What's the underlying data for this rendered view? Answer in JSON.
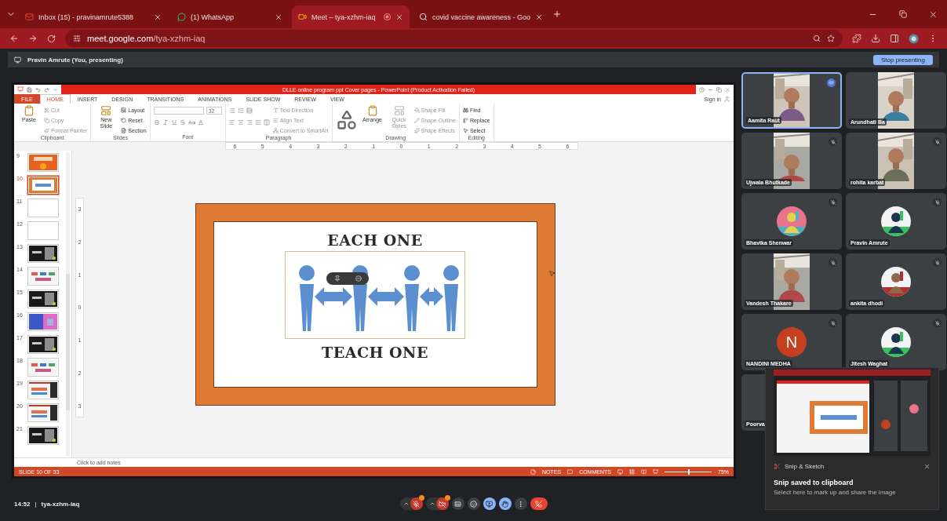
{
  "browser": {
    "tabs": [
      {
        "title": "Inbox (15) - pravinamrute5388",
        "selected": false,
        "recording": false
      },
      {
        "title": "(1) WhatsApp",
        "selected": false,
        "recording": false
      },
      {
        "title": "Meet – tya-xzhm-iaq",
        "selected": true,
        "recording": true
      },
      {
        "title": "covid vaccine awareness - Goo",
        "selected": false,
        "recording": false
      }
    ],
    "url_host": "meet.google.com",
    "url_path": "/tya-xzhm-iaq"
  },
  "presenting_bar": {
    "label": "Pravin Amrute (You, presenting)",
    "button": "Stop presenting"
  },
  "powerpoint": {
    "title": "DLLE online program ppt Cover pages - PowerPoint (Product Activation Failed)",
    "sign_in": "Sign in",
    "tabs": [
      {
        "label": "FILE",
        "kind": "file",
        "selected": false
      },
      {
        "label": "HOME",
        "kind": "tab",
        "selected": true
      },
      {
        "label": "INSERT",
        "kind": "tab",
        "selected": false
      },
      {
        "label": "DESIGN",
        "kind": "tab",
        "selected": false
      },
      {
        "label": "TRANSITIONS",
        "kind": "tab",
        "selected": false
      },
      {
        "label": "ANIMATIONS",
        "kind": "tab",
        "selected": false
      },
      {
        "label": "SLIDE SHOW",
        "kind": "tab",
        "selected": false
      },
      {
        "label": "REVIEW",
        "kind": "tab",
        "selected": false
      },
      {
        "label": "VIEW",
        "kind": "tab",
        "selected": false
      }
    ],
    "groups": [
      {
        "label": "Clipboard",
        "kind": "buttons",
        "large": [
          {
            "label": "Paste",
            "disabled": false
          }
        ],
        "small": [
          {
            "label": "Cut",
            "disabled": true
          },
          {
            "label": "Copy",
            "disabled": true
          },
          {
            "label": "Format Painter",
            "disabled": true
          }
        ]
      },
      {
        "label": "Slides",
        "kind": "buttons",
        "large": [
          {
            "label": "New Slide",
            "disabled": false
          }
        ],
        "small": [
          {
            "label": "Layout",
            "disabled": false
          },
          {
            "label": "Reset",
            "disabled": false
          },
          {
            "label": "Section",
            "disabled": false
          }
        ]
      },
      {
        "label": "Font",
        "kind": "font",
        "font_size": "32"
      },
      {
        "label": "Paragraph",
        "kind": "paragraph",
        "small": [
          {
            "label": "Text Direction",
            "disabled": true
          },
          {
            "label": "Align Text",
            "disabled": true
          },
          {
            "label": "Convert to SmartArt",
            "disabled": true
          }
        ]
      },
      {
        "label": "Drawing",
        "kind": "drawing",
        "large": [
          {
            "label": "Arrange",
            "disabled": false
          },
          {
            "label": "Quick Styles",
            "disabled": true
          }
        ],
        "small": [
          {
            "label": "Shape Fill",
            "disabled": true
          },
          {
            "label": "Shape Outline",
            "disabled": true
          },
          {
            "label": "Shape Effects",
            "disabled": true
          }
        ]
      },
      {
        "label": "Editing",
        "kind": "buttons",
        "small": [
          {
            "label": "Find",
            "disabled": false
          },
          {
            "label": "Replace",
            "disabled": false
          },
          {
            "label": "Select",
            "disabled": false
          }
        ]
      }
    ],
    "ruler": [
      "6",
      "5",
      "4",
      "3",
      "2",
      "1",
      "0",
      "1",
      "2",
      "3",
      "4",
      "5",
      "6"
    ],
    "vertical_ruler": [
      "3",
      "2",
      "1",
      "0",
      "1",
      "2",
      "3"
    ],
    "thumbnails": [
      {
        "number": "9",
        "kind": "orange",
        "selected": false
      },
      {
        "number": "10",
        "kind": "frame",
        "selected": true
      },
      {
        "number": "11",
        "kind": "blank",
        "selected": false
      },
      {
        "number": "12",
        "kind": "blank",
        "selected": false
      },
      {
        "number": "13",
        "kind": "dark",
        "selected": false
      },
      {
        "number": "14",
        "kind": "light",
        "selected": false
      },
      {
        "number": "15",
        "kind": "dark",
        "selected": false
      },
      {
        "number": "16",
        "kind": "pink",
        "selected": false
      },
      {
        "number": "17",
        "kind": "dark",
        "selected": false
      },
      {
        "number": "18",
        "kind": "light",
        "selected": false
      },
      {
        "number": "19",
        "kind": "split",
        "selected": false
      },
      {
        "number": "20",
        "kind": "split",
        "selected": false
      },
      {
        "number": "21",
        "kind": "dark",
        "selected": false
      }
    ],
    "slide": {
      "title": "EACH ONE",
      "subtitle": "TEACH ONE",
      "shape_selected": true
    },
    "notes_placeholder": "Click to add notes",
    "status": {
      "slide": "SLIDE 10 OF 33",
      "notes": "NOTES",
      "comments": "COMMENTS",
      "zoom": "75%",
      "level": 0.5
    }
  },
  "participants": [
    {
      "name": "Aamita Raut",
      "kind": "video",
      "speaking": true,
      "muted": false
    },
    {
      "name": "Arundhati Ba",
      "kind": "video",
      "speaking": false,
      "muted": false
    },
    {
      "name": "Ujwala Bhutkade",
      "kind": "video",
      "speaking": false,
      "muted": true
    },
    {
      "name": "rohita karbat",
      "kind": "video",
      "speaking": false,
      "muted": true
    },
    {
      "name": "Bhavika Shenwar",
      "kind": "avatar",
      "speaking": false,
      "muted": true
    },
    {
      "name": "Pravin Amrute",
      "kind": "avatar",
      "speaking": false,
      "muted": true
    },
    {
      "name": "Vandesh Thakare",
      "kind": "video",
      "speaking": false,
      "muted": true
    },
    {
      "name": "ankita dhodi",
      "kind": "avatar",
      "speaking": false,
      "muted": true
    },
    {
      "name": "NANDINI MEDHA",
      "kind": "initial",
      "initial": "N",
      "color": "#c5401f",
      "speaking": false,
      "muted": true
    },
    {
      "name": "Jitesh Waghat",
      "kind": "avatar",
      "speaking": false,
      "muted": true
    },
    {
      "name": "Poorva",
      "kind": "none",
      "speaking": false
    }
  ],
  "meeting": {
    "time": "14:52",
    "separator": "|",
    "code": "tya-xzhm-iaq",
    "controls": [
      {
        "kind": "mic",
        "on": false,
        "alert": true
      },
      {
        "kind": "camera",
        "on": false,
        "alert": true
      },
      {
        "kind": "captions",
        "on": false,
        "alert": false
      },
      {
        "kind": "emoji",
        "on": false,
        "alert": false
      },
      {
        "kind": "present",
        "on": true,
        "alert": false
      },
      {
        "kind": "hand",
        "on": true,
        "alert": false
      },
      {
        "kind": "more",
        "on": false,
        "alert": false
      },
      {
        "kind": "leave",
        "on": false,
        "alert": false
      }
    ]
  },
  "notification": {
    "app": "Snip & Sketch",
    "title": "Snip saved to clipboard",
    "body": "Select here to mark up and share the image"
  }
}
